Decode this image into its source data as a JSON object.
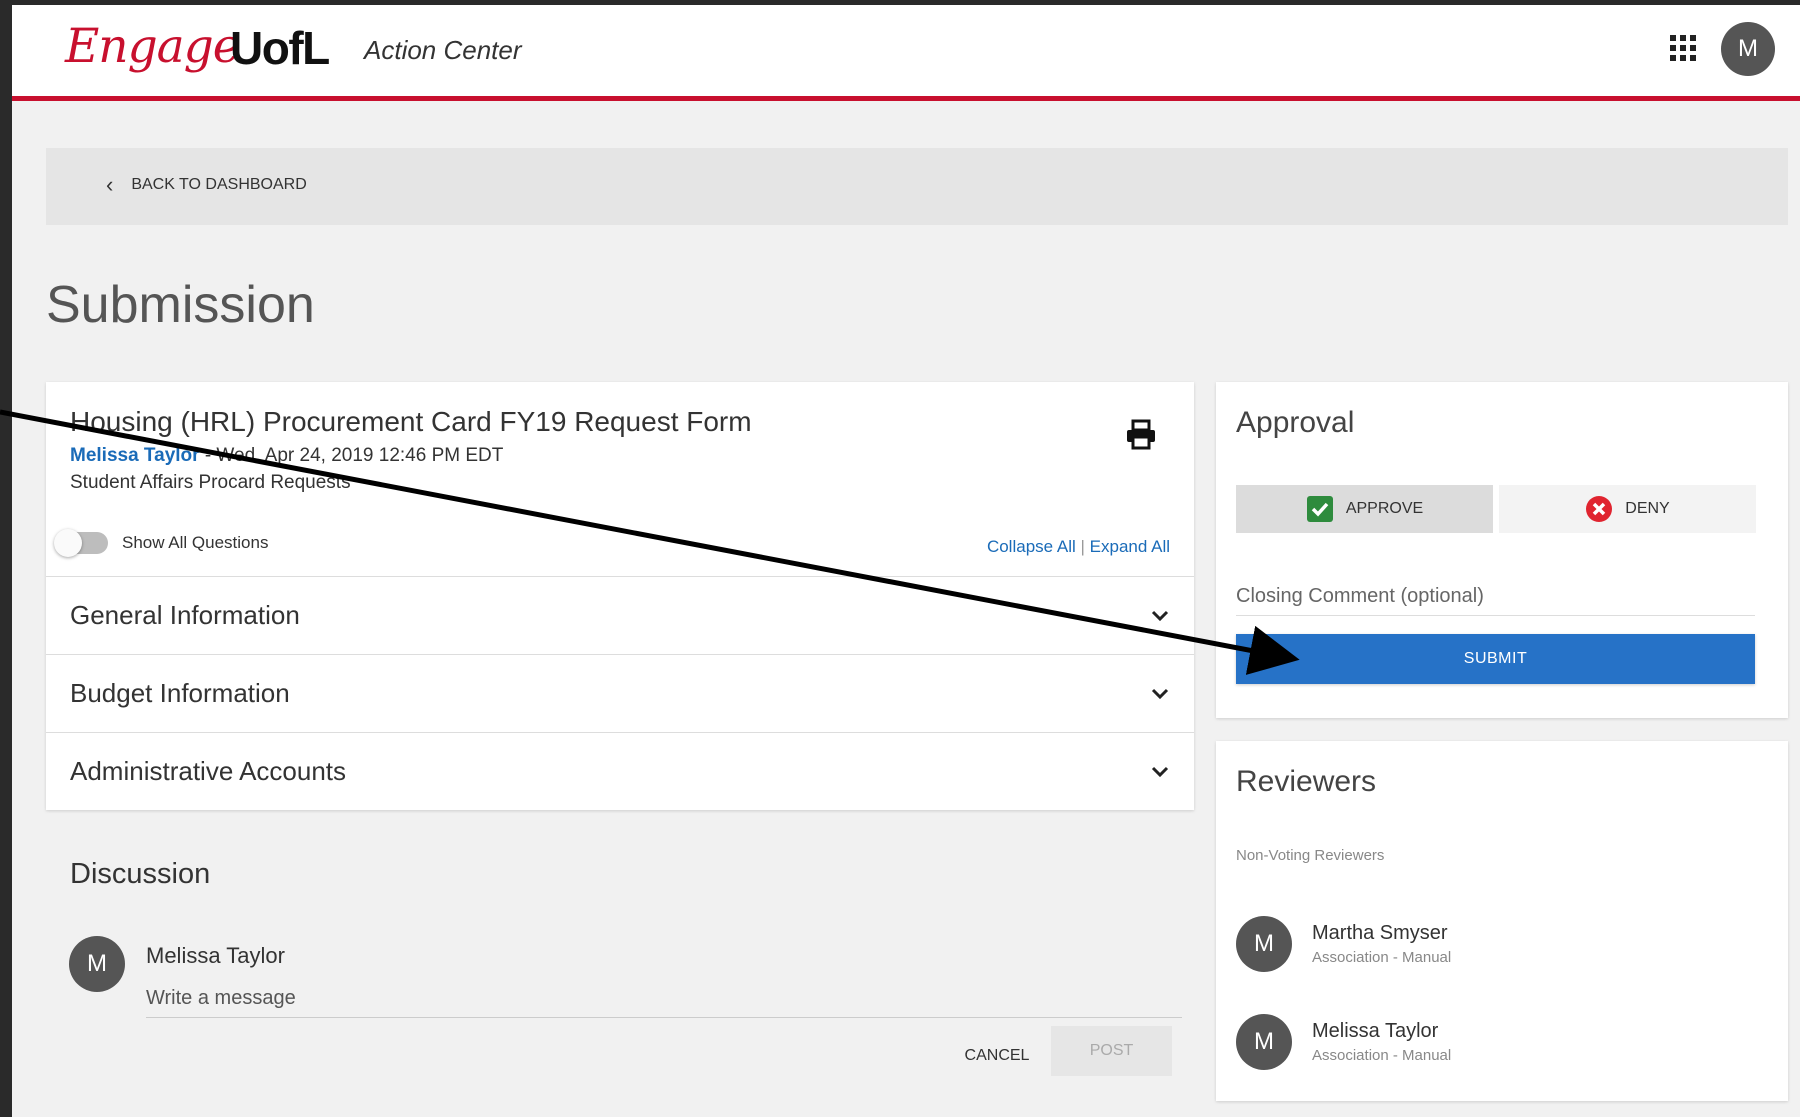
{
  "header": {
    "logo_engage": "Engage",
    "logo_uofl": "UofL",
    "app_title": "Action Center",
    "avatar_initial": "M"
  },
  "backbar": {
    "label": "BACK TO DASHBOARD"
  },
  "page": {
    "title": "Submission"
  },
  "form": {
    "title": "Housing (HRL) Procurement Card FY19 Request Form",
    "author": "Melissa Taylor",
    "date": " - Wed, Apr 24, 2019 12:46 PM EDT",
    "subtitle": "Student Affairs Procard Requests",
    "toggle_label": "Show All Questions",
    "collapse_all": "Collapse All",
    "separator": " | ",
    "expand_all": "Expand All",
    "sections": [
      {
        "title": "General Information"
      },
      {
        "title": "Budget Information"
      },
      {
        "title": "Administrative Accounts"
      }
    ]
  },
  "discussion": {
    "title": "Discussion",
    "avatar_initial": "M",
    "user_name": "Melissa Taylor",
    "placeholder": "Write a message",
    "cancel_label": "CANCEL",
    "post_label": "POST"
  },
  "approval": {
    "title": "Approval",
    "approve_label": "APPROVE",
    "deny_label": "DENY",
    "comment_placeholder": "Closing Comment (optional)",
    "submit_label": "SUBMIT",
    "colors": {
      "approve": "#2e8b3d",
      "deny": "#e0242f",
      "submit": "#2672c7"
    }
  },
  "reviewers": {
    "title": "Reviewers",
    "subtitle": "Non-Voting Reviewers",
    "items": [
      {
        "initial": "M",
        "name": "Martha Smyser",
        "role": "Association - Manual"
      },
      {
        "initial": "M",
        "name": "Melissa Taylor",
        "role": "Association - Manual"
      }
    ]
  },
  "theme": {
    "brand_red": "#c8102e",
    "link_blue": "#1a6bb8"
  }
}
